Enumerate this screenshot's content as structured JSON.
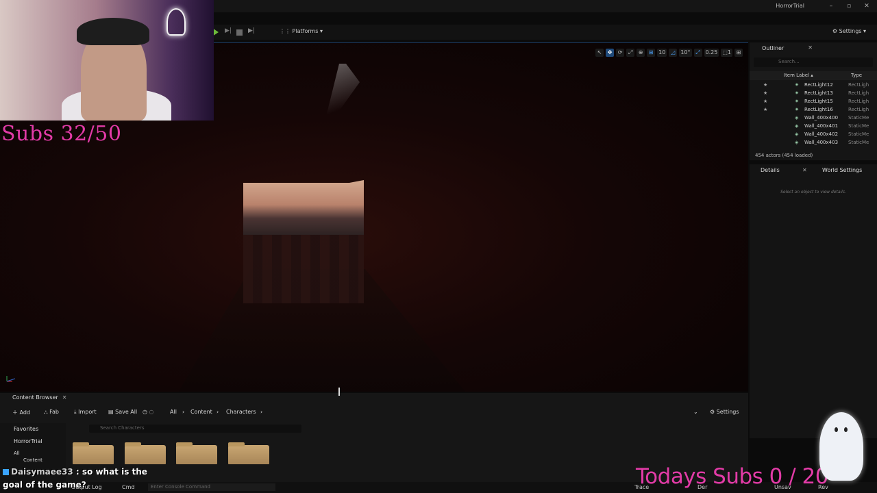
{
  "window": {
    "project": "HorrorTrial",
    "minimize": "–",
    "maximize": "▫",
    "close": "✕"
  },
  "toolbar": {
    "platforms_label": "Platforms",
    "settings_label": "Settings",
    "step_glyph": "▶|",
    "eject_glyph": "▶|"
  },
  "viewport": {
    "tools": [
      "↖",
      "✥",
      "⟳",
      "⤢",
      "⊕",
      "⊞",
      "10",
      "◿",
      "10°",
      "⤢",
      "0.25",
      "⬚1",
      "⊞"
    ]
  },
  "webcam": {
    "subs_text": "Subs 32/50"
  },
  "outliner": {
    "tab_label": "Outliner",
    "search_placeholder": "Search...",
    "col_label": "Item Label ▴",
    "col_type": "Type",
    "rows": [
      {
        "name": "RectLight12",
        "type": "RectLigh"
      },
      {
        "name": "RectLight13",
        "type": "RectLigh"
      },
      {
        "name": "RectLight15",
        "type": "RectLigh"
      },
      {
        "name": "RectLight16",
        "type": "RectLigh"
      },
      {
        "name": "Wall_400x400",
        "type": "StaticMe"
      },
      {
        "name": "Wall_400x401",
        "type": "StaticMe"
      },
      {
        "name": "Wall_400x402",
        "type": "StaticMe"
      },
      {
        "name": "Wall_400x403",
        "type": "StaticMe"
      }
    ],
    "actors_count": "454 actors (454 loaded)"
  },
  "details": {
    "tab_details": "Details",
    "tab_world": "World Settings",
    "hint": "Select an object to view details."
  },
  "content_browser": {
    "tab_label": "Content Browser",
    "add": "Add",
    "fab": "Fab",
    "import": "Import",
    "save_all": "Save All",
    "breadcrumbs": [
      "All",
      "Content",
      "Characters"
    ],
    "settings": "Settings",
    "search_placeholder": "Search Characters",
    "tree": {
      "favorites": "Favorites",
      "project": "HorrorTrial",
      "all": "All",
      "content": "Content"
    }
  },
  "bottombar": {
    "output_log": "Output Log",
    "cmd": "Cmd",
    "console_placeholder": "Enter Console Command",
    "trace": "Trace",
    "derived": "Der",
    "unsaved": "Unsav",
    "rev": "Rev"
  },
  "chat": {
    "username": "Daisymaee33",
    "message": ": so what is the goal of the game?"
  },
  "overlay": {
    "today_subs": "Todays Subs 0 / 20"
  }
}
